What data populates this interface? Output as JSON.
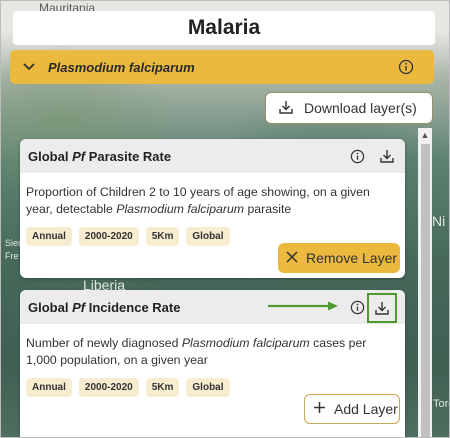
{
  "app": {
    "title": "Malaria"
  },
  "map": {
    "labels": [
      "Mauritania",
      "Liberia",
      "Ni",
      "Sier",
      "Fre",
      "Toro"
    ]
  },
  "species": {
    "name": "Plasmodium falciparum"
  },
  "download_all": {
    "label": "Download layer(s)"
  },
  "colors": {
    "accent": "#ebb93d",
    "highlight": "#4f9a2e",
    "tag_bg": "#f8ecd0"
  },
  "icons": {
    "chevron": "chevron-down-icon",
    "info": "info-icon",
    "download": "download-icon",
    "close": "close-icon",
    "plus": "plus-icon",
    "arrow": "arrow-right-icon"
  },
  "layers": [
    {
      "title_prefix": "Global",
      "title_italic": "Pf",
      "title_suffix": "Parasite Rate",
      "desc_before": "Proportion of Children 2 to 10 years of age showing, on a given year, detectable",
      "desc_italic": "Plasmodium falciparum",
      "desc_after": "parasite",
      "tags": [
        "Annual",
        "2000-2020",
        "5Km",
        "Global"
      ],
      "action_label": "Remove Layer"
    },
    {
      "title_prefix": "Global",
      "title_italic": "Pf",
      "title_suffix": "Incidence Rate",
      "desc_before": "Number of newly diagnosed",
      "desc_italic": "Plasmodium falciparum",
      "desc_after": "cases per 1,000 population, on a given year",
      "tags": [
        "Annual",
        "2000-2020",
        "5Km",
        "Global"
      ],
      "action_label": "Add Layer"
    }
  ]
}
